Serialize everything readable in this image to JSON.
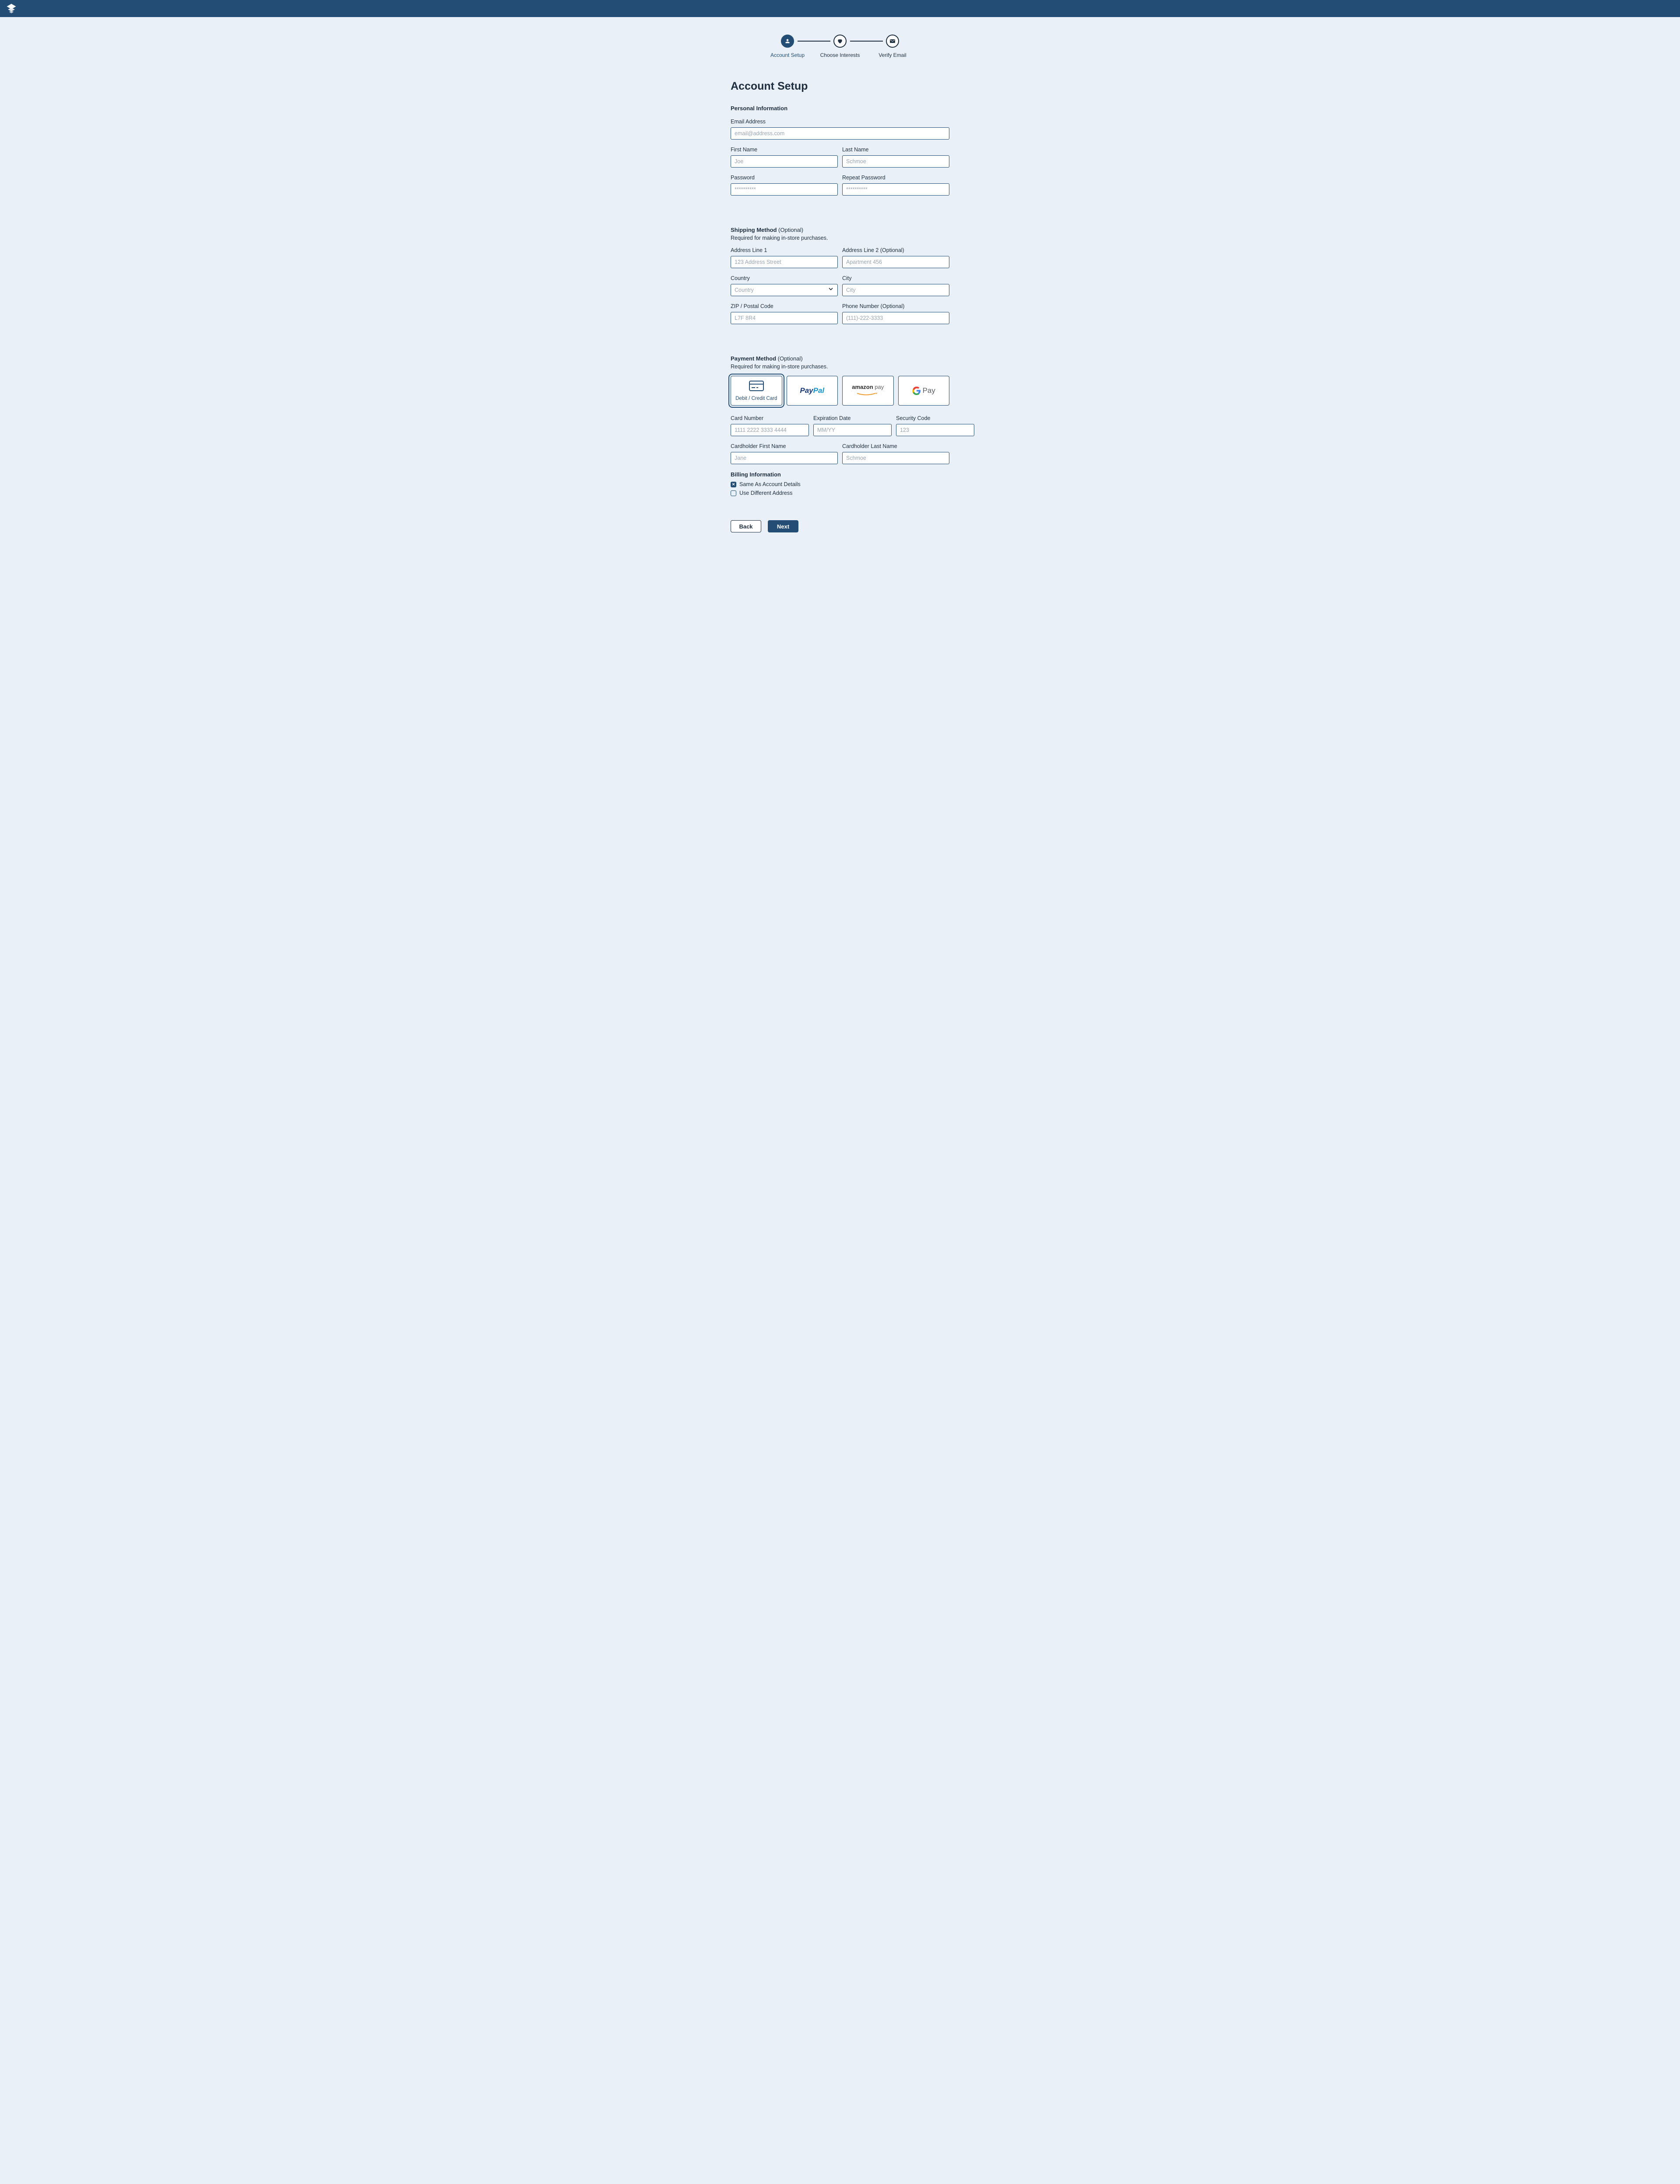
{
  "stepper": {
    "steps": [
      {
        "label": "Account Setup"
      },
      {
        "label": "Choose Interests"
      },
      {
        "label": "Verify Email"
      }
    ]
  },
  "page": {
    "title": "Account Setup"
  },
  "personal": {
    "title": "Personal Information",
    "email_label": "Email Address",
    "email_placeholder": "email@address.com",
    "first_name_label": "First Name",
    "first_name_placeholder": "Joe",
    "last_name_label": "Last Name",
    "last_name_placeholder": "Schmoe",
    "password_label": "Password",
    "password_placeholder": "**********",
    "repeat_password_label": "Repeat Password",
    "repeat_password_placeholder": "**********"
  },
  "shipping": {
    "title": "Shipping Method",
    "optional": " (Optional)",
    "subtitle": "Required for making in-store purchases.",
    "address1_label": "Address Line 1",
    "address1_placeholder": "123 Address Street",
    "address2_label": "Address Line 2 (Optional)",
    "address2_placeholder": "Apartment 456",
    "country_label": "Country",
    "country_placeholder": "Country",
    "city_label": "City",
    "city_placeholder": "City",
    "zip_label": "ZIP / Postal Code",
    "zip_placeholder": "L7F 8R4",
    "phone_label": "Phone Number (Optional)",
    "phone_placeholder": "(111)-222-3333"
  },
  "payment": {
    "title": "Payment Method",
    "optional": " (Optional)",
    "subtitle": "Required for making in-store purchases.",
    "options": {
      "card": "Debit / Credit Card",
      "paypal": "PayPal",
      "amazon": "amazon pay",
      "gpay": "G Pay"
    },
    "card_number_label": "Card Number",
    "card_number_placeholder": "1111 2222 3333 4444",
    "exp_label": "Expiration Date",
    "exp_placeholder": "MM/YY",
    "cvc_label": "Security Code",
    "cvc_placeholder": "123",
    "ch_first_label": "Cardholder First Name",
    "ch_first_placeholder": "Jane",
    "ch_last_label": "Cardholder Last Name",
    "ch_last_placeholder": "Schmoe"
  },
  "billing": {
    "title": "Billing Information",
    "same": "Same As Account Details",
    "different": "Use Different Address"
  },
  "actions": {
    "back": "Back",
    "next": "Next"
  }
}
